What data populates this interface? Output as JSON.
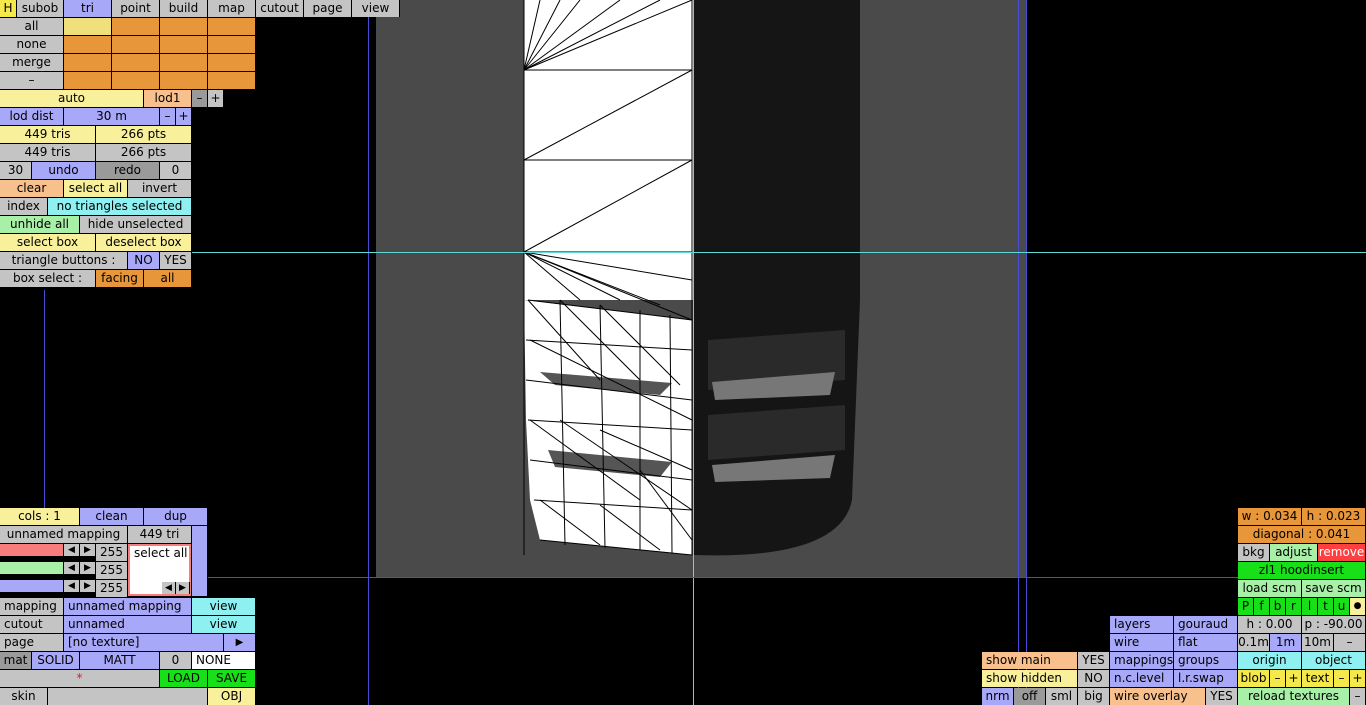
{
  "toolbar": {
    "h": "H",
    "subob": "subob",
    "tri": "tri",
    "point": "point",
    "build": "build",
    "map": "map",
    "cutout": "cutout",
    "page": "page",
    "view": "view"
  },
  "sel": {
    "all": "all",
    "none": "none",
    "merge": "merge",
    "minus": "–"
  },
  "lod": {
    "auto": "auto",
    "lod1": "lod1",
    "minus": "–",
    "plus": "+",
    "dist_label": "lod dist",
    "dist_value": "30 m"
  },
  "counts": {
    "tris1": "449 tris",
    "pts1": "266 pts",
    "tris2": "449 tris",
    "pts2": "266 pts"
  },
  "history": {
    "n": "30",
    "undo": "undo",
    "redo": "redo",
    "zero": "0"
  },
  "selection": {
    "clear": "clear",
    "select_all": "select all",
    "invert": "invert",
    "index": "index",
    "status": "no triangles selected",
    "unhide_all": "unhide all",
    "hide_unselected": "hide unselected",
    "select_box": "select box",
    "deselect_box": "deselect box",
    "tri_buttons": "triangle buttons :",
    "no": "NO",
    "yes": "YES",
    "box_select": "box select :",
    "facing": "facing",
    "all": "all"
  },
  "colors": {
    "cols": "cols : 1",
    "clean": "clean",
    "dup": "dup",
    "mapping": "unnamed mapping",
    "tris": "449 tri",
    "v1": "255",
    "v2": "255",
    "v3": "255",
    "select_all": "select all",
    "left": "◀",
    "right": "▶",
    "red": "#f87c7c",
    "green": "#a8f0a8",
    "blue": "#a8a8f8"
  },
  "material": {
    "mapping_label": "mapping",
    "mapping_value": "unnamed mapping",
    "view": "view",
    "cutout_label": "cutout",
    "cutout_value": "unnamed",
    "page_label": "page",
    "page_value": "[no texture]",
    "arrow": "▶",
    "mat": "mat",
    "solid": "SOLID",
    "matt": "MATT",
    "zero": "0",
    "none": "NONE",
    "star": "*",
    "load": "LOAD",
    "save": "SAVE",
    "skin": "skin",
    "obj": "OBJ"
  },
  "right": {
    "w": "w : 0.034",
    "h": "h : 0.023",
    "diagonal": "diagonal : 0.041",
    "bkg": "bkg",
    "adjust": "adjust",
    "remove": "remove",
    "name": "zl1 hoodinsert",
    "load_scm": "load scm",
    "save_scm": "save scm",
    "flags": [
      "P",
      "f",
      "b",
      "r",
      "l",
      "t",
      "u",
      "●"
    ],
    "hval": "h : 0.00",
    "pval": "p : -90.00",
    "s01": "0.1m",
    "s1": "1m",
    "s10": "10m",
    "sm": "–",
    "origin": "origin",
    "object": "object",
    "blob": "blob",
    "text": "text",
    "minus": "–",
    "plus": "+",
    "reload": "reload textures"
  },
  "view_opts": {
    "layers": "layers",
    "gouraud": "gouraud",
    "wire": "wire",
    "flat": "flat",
    "mappings": "mappings",
    "groups": "groups",
    "nclevel": "n.c.level",
    "lrswap": "l.r.swap",
    "show_main": "show main",
    "yes1": "YES",
    "show_hidden": "show hidden",
    "no": "NO",
    "nrm": "nrm",
    "off": "off",
    "sml": "sml",
    "big": "big",
    "wire_overlay": "wire overlay",
    "yes2": "YES"
  }
}
